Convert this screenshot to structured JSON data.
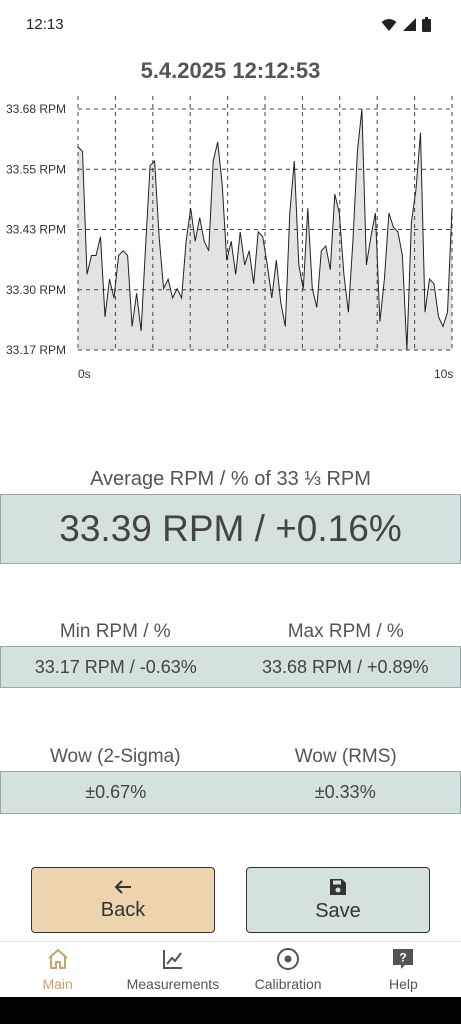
{
  "status": {
    "time": "12:13"
  },
  "chart_title": "5.4.2025 12:12:53",
  "chart_data": {
    "type": "area",
    "title": "5.4.2025 12:12:53",
    "y_ticks": [
      "33.68 RPM",
      "33.55 RPM",
      "33.43 RPM",
      "33.30 RPM",
      "33.17 RPM"
    ],
    "x_ticks": [
      "0s",
      "10s"
    ],
    "ylim": [
      33.17,
      33.68
    ],
    "xlim": [
      0,
      10
    ],
    "grid": true,
    "values": [
      33.6,
      33.59,
      33.33,
      33.37,
      33.37,
      33.41,
      33.24,
      33.32,
      33.28,
      33.37,
      33.38,
      33.37,
      33.22,
      33.29,
      33.21,
      33.39,
      33.56,
      33.57,
      33.41,
      33.3,
      33.32,
      33.28,
      33.3,
      33.28,
      33.4,
      33.47,
      33.4,
      33.45,
      33.4,
      33.38,
      33.57,
      33.61,
      33.52,
      33.36,
      33.4,
      33.33,
      33.42,
      33.35,
      33.38,
      33.31,
      33.42,
      33.41,
      33.35,
      33.28,
      33.36,
      33.27,
      33.22,
      33.46,
      33.57,
      33.35,
      33.3,
      33.47,
      33.3,
      33.26,
      33.38,
      33.39,
      33.34,
      33.5,
      33.46,
      33.33,
      33.25,
      33.4,
      33.59,
      33.68,
      33.35,
      33.41,
      33.46,
      33.23,
      33.32,
      33.46,
      33.43,
      33.42,
      33.37,
      33.17,
      33.44,
      33.51,
      33.63,
      33.25,
      33.32,
      33.31,
      33.24,
      33.22,
      33.25,
      33.47
    ]
  },
  "average": {
    "label": "Average RPM / % of 33 ⅓ RPM",
    "value": "33.39 RPM / +0.16%"
  },
  "minmax": {
    "min_label": "Min RPM / %",
    "max_label": "Max RPM / %",
    "min_value": "33.17 RPM / -0.63%",
    "max_value": "33.68 RPM / +0.89%"
  },
  "wow": {
    "sigma_label": "Wow (2-Sigma)",
    "rms_label": "Wow (RMS)",
    "sigma_value": "±0.67%",
    "rms_value": "±0.33%"
  },
  "buttons": {
    "back": "Back",
    "save": "Save",
    "back_icon": "arrow-left-icon",
    "save_icon": "floppy-disk-icon"
  },
  "nav": [
    {
      "label": "Main",
      "icon": "home-icon",
      "active": true
    },
    {
      "label": "Measurements",
      "icon": "line-chart-icon",
      "active": false
    },
    {
      "label": "Calibration",
      "icon": "target-icon",
      "active": false
    },
    {
      "label": "Help",
      "icon": "help-icon",
      "active": false
    }
  ],
  "colors": {
    "accent": "#c9a46a",
    "panel": "#d3e1df",
    "back_button": "#ecd4ae"
  }
}
